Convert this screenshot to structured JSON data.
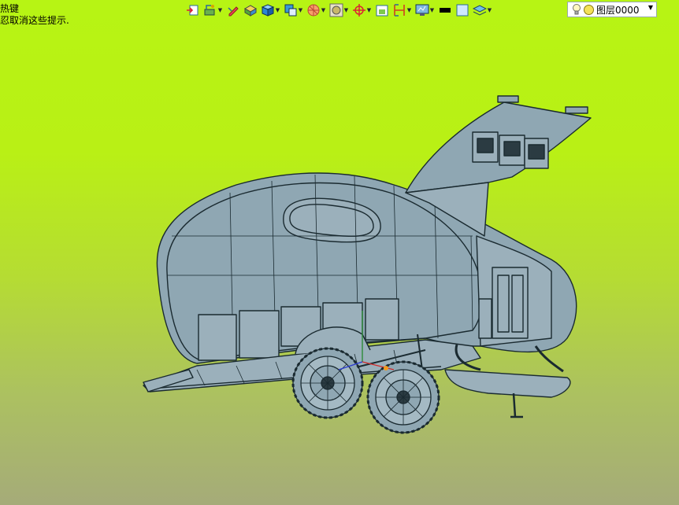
{
  "hint": {
    "line1": "热键",
    "line2": "忍取消这些提示."
  },
  "toolbar": {
    "items": [
      {
        "icon": "view-select-icon",
        "dropdown": false
      },
      {
        "icon": "snap-mode-icon",
        "dropdown": true
      },
      {
        "icon": "edit-tool-icon",
        "dropdown": false
      },
      {
        "icon": "shaded-display-icon",
        "dropdown": false
      },
      {
        "icon": "solid-box-icon",
        "dropdown": true
      },
      {
        "icon": "view-orient-icon",
        "dropdown": true
      },
      {
        "icon": "section-view-icon",
        "dropdown": true
      },
      {
        "icon": "render-style-icon",
        "dropdown": true
      },
      {
        "icon": "wcs-orient-icon",
        "dropdown": true
      },
      {
        "icon": "fit-view-icon",
        "dropdown": false
      },
      {
        "icon": "dimension-icon",
        "dropdown": true
      },
      {
        "icon": "display-settings-icon",
        "dropdown": true
      },
      {
        "icon": "line-color-icon",
        "dropdown": false
      },
      {
        "icon": "background-color-icon",
        "dropdown": false
      },
      {
        "icon": "layer-manager-icon",
        "dropdown": true
      }
    ]
  },
  "layer": {
    "current": "图层0000"
  },
  "colors": {
    "model_fill": "#8fa7b3",
    "model_stroke": "#1a2a30",
    "bg_top": "#b7f414",
    "bg_bottom": "#a5ab79"
  }
}
